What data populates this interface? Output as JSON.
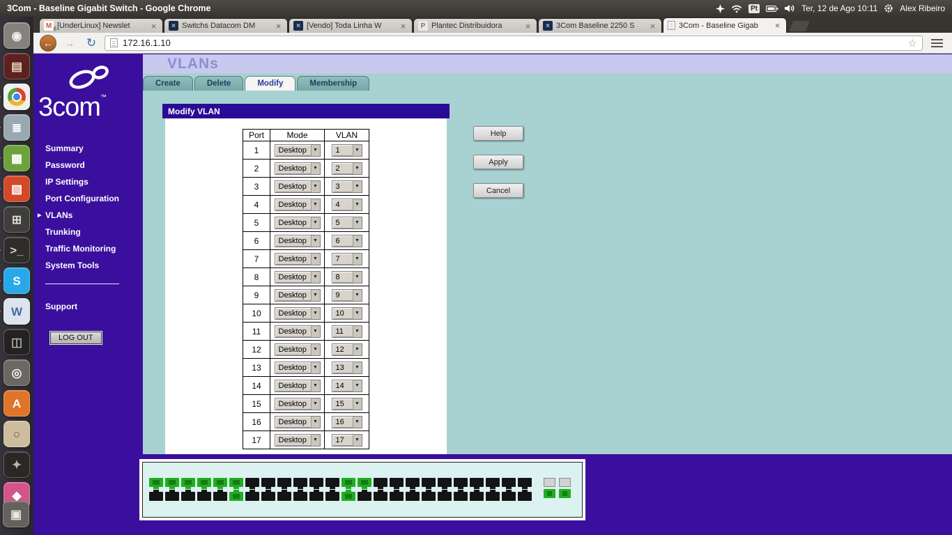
{
  "topbar": {
    "window_title": "3Com - Baseline Gigabit Switch - Google Chrome",
    "keyboard_layout": "Pt",
    "clock": "Ter, 12 de Ago 10:11",
    "user_name": "Alex Ribeiro"
  },
  "launcher": {
    "items": [
      {
        "name": "dash-home",
        "glyph": "◉",
        "bg": "#84827c",
        "fg": "#f0efec",
        "running": false
      },
      {
        "name": "archive-manager",
        "glyph": "▤",
        "bg": "#5d2120",
        "fg": "#e6d2b8",
        "running": false
      },
      {
        "name": "chrome",
        "glyph": "",
        "bg": "#f2f0ec",
        "fg": "#ffffff",
        "running": true
      },
      {
        "name": "gedit",
        "glyph": "≣",
        "bg": "#9aa8b4",
        "fg": "#ffffff",
        "running": true
      },
      {
        "name": "libreoffice-calc",
        "glyph": "▦",
        "bg": "#6da23c",
        "fg": "#ffffff",
        "running": true
      },
      {
        "name": "libreoffice-impress",
        "glyph": "▧",
        "bg": "#d3492a",
        "fg": "#ffffff",
        "running": true
      },
      {
        "name": "calculator",
        "glyph": "⊞",
        "bg": "#3f3e3b",
        "fg": "#d8d8d8",
        "running": false
      },
      {
        "name": "terminal",
        "glyph": ">_",
        "bg": "#2f2d2a",
        "fg": "#cfcfcf",
        "running": true
      },
      {
        "name": "skype",
        "glyph": "S",
        "bg": "#28a8e8",
        "fg": "#ffffff",
        "running": true
      },
      {
        "name": "wxmaxima",
        "glyph": "W",
        "bg": "#dce4ee",
        "fg": "#4a6a9c",
        "running": true
      },
      {
        "name": "media-app",
        "glyph": "◫",
        "bg": "#232220",
        "fg": "#b0b0b0",
        "running": false
      },
      {
        "name": "screenshot-tool",
        "glyph": "◎",
        "bg": "#6a6862",
        "fg": "#f0f0f0",
        "running": false
      },
      {
        "name": "software-center",
        "glyph": "A",
        "bg": "#e07428",
        "fg": "#ffffff",
        "running": false
      },
      {
        "name": "search-tool",
        "glyph": "○",
        "bg": "#cdbd9e",
        "fg": "#5a4a33",
        "running": false
      },
      {
        "name": "gimp",
        "glyph": "✦",
        "bg": "#2a2724",
        "fg": "#b8b4ae",
        "running": false
      },
      {
        "name": "usb-creator",
        "glyph": "◆",
        "bg": "#d4548c",
        "fg": "#ffffff",
        "running": false
      }
    ],
    "trash": {
      "name": "trash",
      "glyph": "▣",
      "bg": "#64625c",
      "fg": "#e8e6e3"
    }
  },
  "browser": {
    "url": "172.16.1.10",
    "tabs": [
      {
        "label": "[UnderLinux] Newslet",
        "icon": "gmail-icon",
        "glyph": "M",
        "icon_bg": "#ffffff",
        "icon_fg": "#d94f3d",
        "badge": "6",
        "active": false
      },
      {
        "label": "Switchs Datacom DM",
        "icon": "underlinux-icon",
        "glyph": "×",
        "icon_bg": "#1d2b4a",
        "icon_fg": "#7fd4ff",
        "active": false
      },
      {
        "label": "[Vendo] Toda Linha W",
        "icon": "underlinux-icon",
        "glyph": "×",
        "icon_bg": "#1d2b4a",
        "icon_fg": "#7fd4ff",
        "active": false
      },
      {
        "label": "Plantec Distribuidora",
        "icon": "plantec-icon",
        "glyph": "P",
        "icon_bg": "#e9e9e9",
        "icon_fg": "#787878",
        "active": false
      },
      {
        "label": "3Com Baseline 2250 S",
        "icon": "underlinux-icon",
        "glyph": "×",
        "icon_bg": "#1d2b4a",
        "icon_fg": "#7fd4ff",
        "active": false
      },
      {
        "label": "3Com - Baseline Gigab",
        "icon": "page-icon",
        "glyph": "",
        "icon_bg": "#f4f4f4",
        "icon_fg": "#9a9a9a",
        "active": true
      }
    ]
  },
  "app": {
    "logo_text": "3com",
    "logo_tm": "™",
    "page_title": "VLANs",
    "sidebar": {
      "items": [
        {
          "label": "Summary",
          "active": false
        },
        {
          "label": "Password",
          "active": false
        },
        {
          "label": "IP Settings",
          "active": false
        },
        {
          "label": "Port Configuration",
          "active": false
        },
        {
          "label": "VLANs",
          "active": true
        },
        {
          "label": "Trunking",
          "active": false
        },
        {
          "label": "Traffic Monitoring",
          "active": false
        },
        {
          "label": "System Tools",
          "active": false
        }
      ],
      "support_label": "Support",
      "logout_label": "LOG OUT"
    },
    "tabs": [
      {
        "label": "Create",
        "active": false
      },
      {
        "label": "Delete",
        "active": false
      },
      {
        "label": "Modify",
        "active": true
      },
      {
        "label": "Membership",
        "active": false
      }
    ],
    "panel_title": "Modify VLAN",
    "table": {
      "headers": [
        "Port",
        "Mode",
        "VLAN"
      ],
      "rows": [
        {
          "port": "1",
          "mode": "Desktop",
          "vlan": "1"
        },
        {
          "port": "2",
          "mode": "Desktop",
          "vlan": "2"
        },
        {
          "port": "3",
          "mode": "Desktop",
          "vlan": "3"
        },
        {
          "port": "4",
          "mode": "Desktop",
          "vlan": "4"
        },
        {
          "port": "5",
          "mode": "Desktop",
          "vlan": "5"
        },
        {
          "port": "6",
          "mode": "Desktop",
          "vlan": "6"
        },
        {
          "port": "7",
          "mode": "Desktop",
          "vlan": "7"
        },
        {
          "port": "8",
          "mode": "Desktop",
          "vlan": "8"
        },
        {
          "port": "9",
          "mode": "Desktop",
          "vlan": "9"
        },
        {
          "port": "10",
          "mode": "Desktop",
          "vlan": "10"
        },
        {
          "port": "11",
          "mode": "Desktop",
          "vlan": "11"
        },
        {
          "port": "12",
          "mode": "Desktop",
          "vlan": "12"
        },
        {
          "port": "13",
          "mode": "Desktop",
          "vlan": "13"
        },
        {
          "port": "14",
          "mode": "Desktop",
          "vlan": "14"
        },
        {
          "port": "15",
          "mode": "Desktop",
          "vlan": "15"
        },
        {
          "port": "16",
          "mode": "Desktop",
          "vlan": "16"
        },
        {
          "port": "17",
          "mode": "Desktop",
          "vlan": "17"
        }
      ]
    },
    "buttons": [
      "Help",
      "Apply",
      "Cancel"
    ]
  },
  "switch_panel": {
    "rows": [
      {
        "name": "top",
        "ports": [
          1,
          1,
          1,
          1,
          1,
          1,
          0,
          0,
          0,
          0,
          0,
          0,
          1,
          1,
          0,
          0,
          0,
          0,
          0,
          0,
          0,
          0,
          0,
          0
        ]
      },
      {
        "name": "bottom",
        "ports": [
          0,
          0,
          0,
          0,
          0,
          1,
          0,
          0,
          0,
          0,
          0,
          0,
          1,
          0,
          0,
          0,
          0,
          0,
          0,
          0,
          0,
          0,
          0,
          0
        ]
      }
    ],
    "uplink_slots": 2,
    "uplink_green_ports": 2
  },
  "colors": {
    "purple": "#3a0f9e",
    "header_purple": "#2a0b96",
    "teal": "#a8d2d2",
    "lavender_band": "#c9c9ee",
    "panel_cyan": "#dcf2f0",
    "green_port": "#1fae1f"
  }
}
